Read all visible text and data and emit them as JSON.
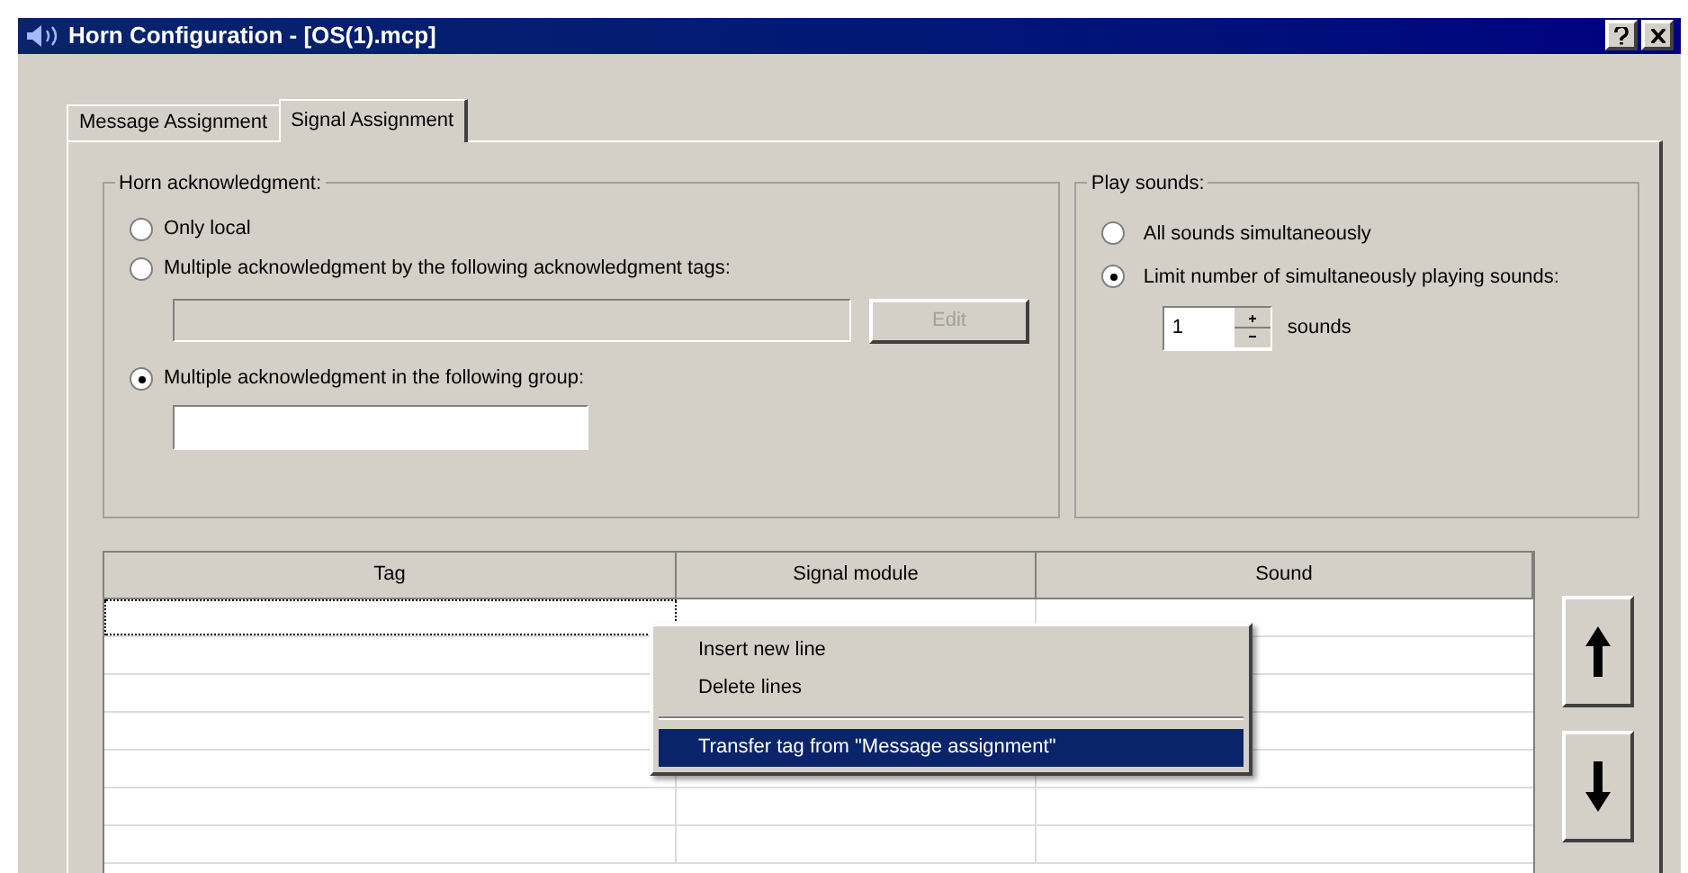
{
  "window": {
    "title": "Horn Configuration - [OS(1).mcp]"
  },
  "tabs": [
    {
      "label": "Message Assignment",
      "selected": false
    },
    {
      "label": "Signal Assignment",
      "selected": true
    }
  ],
  "horn_acknowledgment": {
    "title": "Horn acknowledgment:",
    "options": [
      {
        "label": "Only local",
        "selected": false
      },
      {
        "label": "Multiple acknowledgment by the following acknowledgment tags:",
        "selected": false
      },
      {
        "label": "Multiple acknowledgment in the following group:",
        "selected": true
      }
    ],
    "edit_button": {
      "label": "Edit",
      "disabled": true
    }
  },
  "play_sounds": {
    "title": "Play sounds:",
    "options": [
      {
        "label": "All sounds simultaneously",
        "selected": false
      },
      {
        "label": "Limit number of simultaneously playing sounds:",
        "selected": true
      }
    ],
    "count": "1",
    "unit": "sounds"
  },
  "table": {
    "columns": [
      "Tag",
      "Signal module",
      "Sound"
    ]
  },
  "context_menu": {
    "items": [
      {
        "kind": "item",
        "label": "Insert new line",
        "selected": false
      },
      {
        "kind": "item",
        "label": "Delete lines",
        "selected": false
      },
      {
        "kind": "separator"
      },
      {
        "kind": "item",
        "label": "Transfer tag from \"Message assignment\"",
        "selected": true
      }
    ]
  }
}
